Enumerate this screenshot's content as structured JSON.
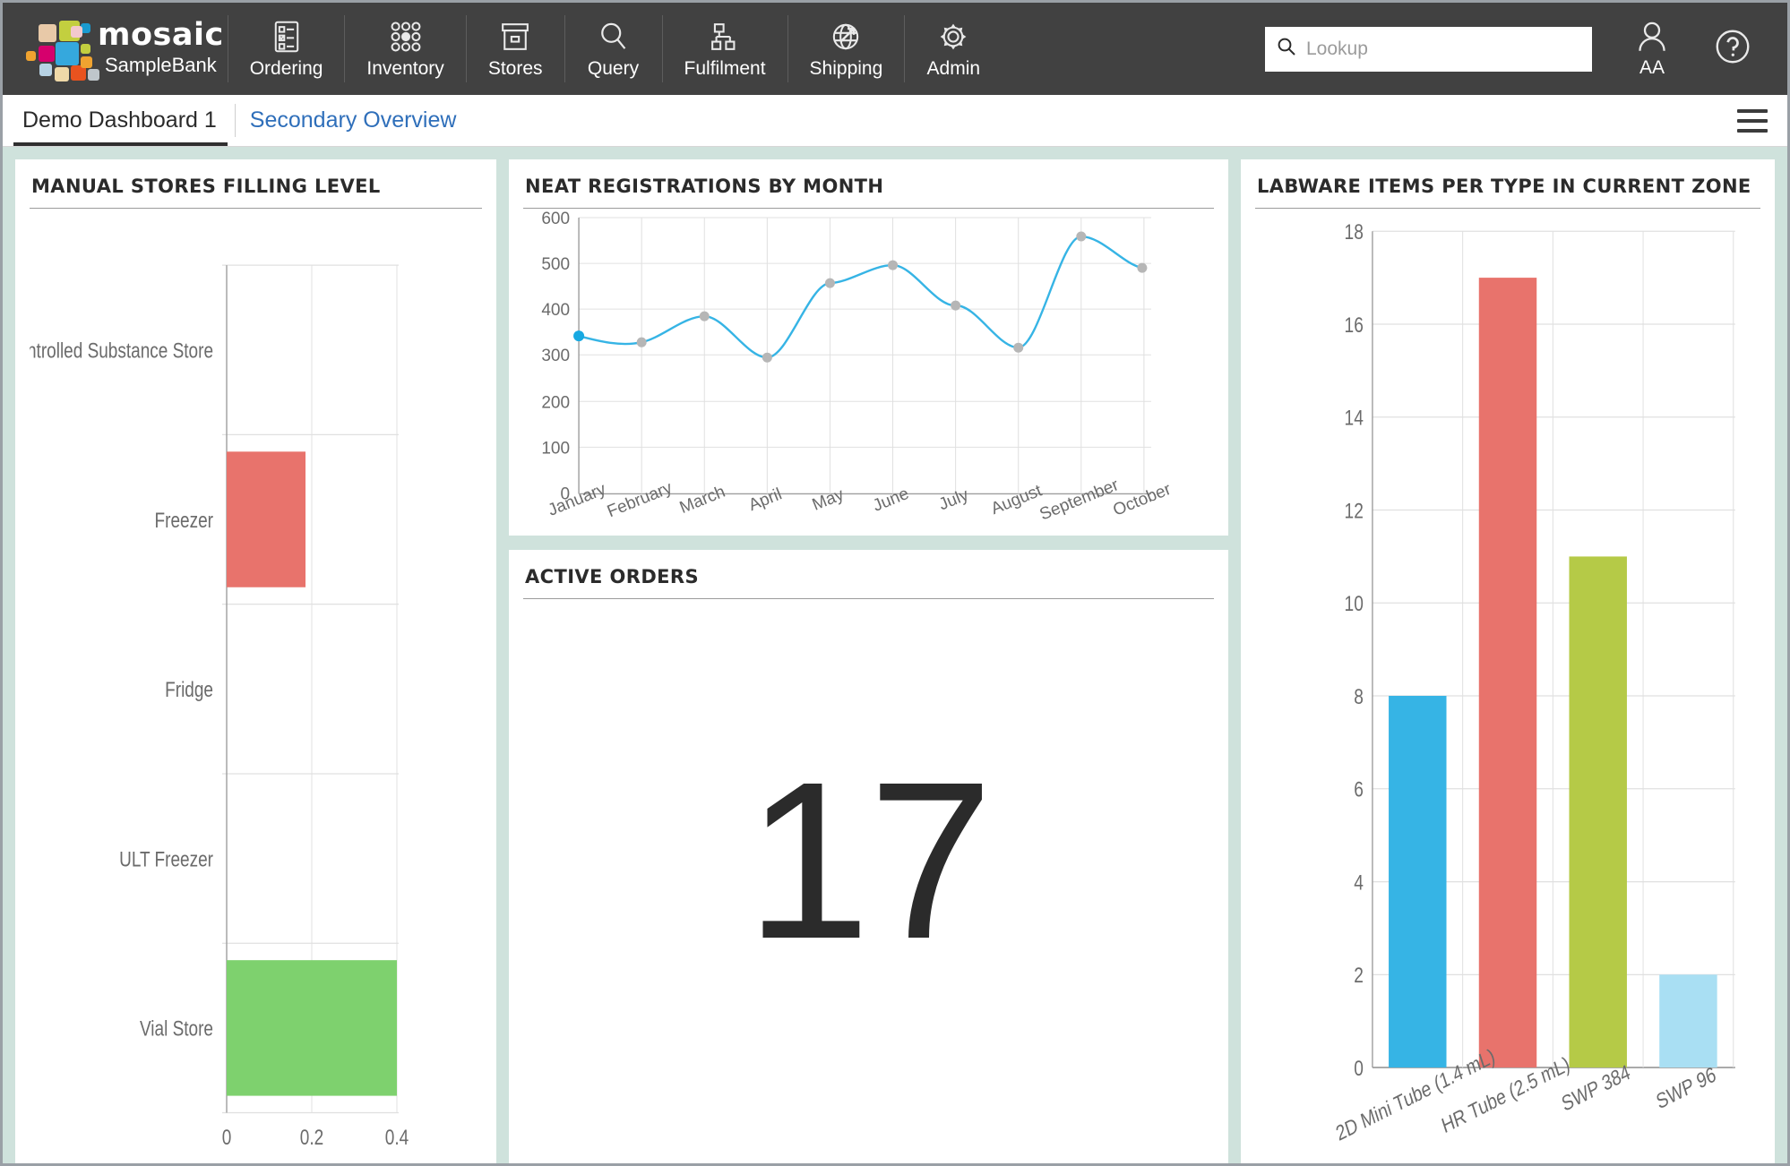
{
  "app": {
    "brand_name": "mosaic",
    "brand_sub": "SampleBank"
  },
  "topnav": {
    "items": [
      {
        "label": "Ordering",
        "icon": "clipboard-check-icon"
      },
      {
        "label": "Inventory",
        "icon": "dot-grid-icon"
      },
      {
        "label": "Stores",
        "icon": "archive-box-icon"
      },
      {
        "label": "Query",
        "icon": "magnifier-icon"
      },
      {
        "label": "Fulfilment",
        "icon": "hierarchy-icon"
      },
      {
        "label": "Shipping",
        "icon": "globe-arrow-icon"
      },
      {
        "label": "Admin",
        "icon": "gear-icon"
      }
    ],
    "search": {
      "placeholder": "Lookup",
      "value": "",
      "icon": "search-icon"
    },
    "user": {
      "initials": "AA",
      "icon": "user-icon"
    },
    "help": {
      "icon": "help-circle-icon"
    }
  },
  "tabs": [
    {
      "label": "Demo Dashboard 1",
      "active": true
    },
    {
      "label": "Secondary Overview",
      "active": false
    }
  ],
  "menu": {
    "icon": "hamburger-icon"
  },
  "cards": {
    "manual_stores": {
      "title": "MANUAL STORES FILLING LEVEL"
    },
    "neat_registrations": {
      "title": "NEAT REGISTRATIONS BY MONTH"
    },
    "active_orders": {
      "title": "ACTIVE ORDERS",
      "value": "17"
    },
    "labware_items": {
      "title": "LABWARE ITEMS PER TYPE IN CURRENT ZONE"
    }
  },
  "colors": {
    "accent_blue": "#36b4e5",
    "red": "#e8736c",
    "green": "#7ed16e",
    "olive": "#b5ca47",
    "light_blue": "#a9dff3",
    "board_bg": "#cfe2dc",
    "topnav_bg": "#414141",
    "tab_link": "#2f6fba"
  },
  "chart_data": [
    {
      "id": "manual_stores_filling_level",
      "type": "bar",
      "orientation": "horizontal",
      "title": "MANUAL STORES FILLING LEVEL",
      "xlabel": "",
      "ylabel": "",
      "categories": [
        "Controlled Substance Store",
        "Freezer",
        "Fridge",
        "ULT Freezer",
        "Vial Store"
      ],
      "values": [
        0,
        0.186,
        0,
        0,
        0.4
      ],
      "bar_colors": [
        "#e8736c",
        "#e8736c",
        "#7ed16e",
        "#7ed16e",
        "#7ed16e"
      ],
      "xlim": [
        0,
        0.4
      ],
      "xticks": [
        0,
        0.2,
        0.4
      ],
      "xticklabels": [
        "0",
        "0.2",
        "0.4"
      ],
      "grid": true,
      "legend": "none"
    },
    {
      "id": "neat_registrations_by_month",
      "type": "line",
      "title": "NEAT REGISTRATIONS BY MONTH",
      "xlabel": "",
      "ylabel": "",
      "categories": [
        "January",
        "February",
        "March",
        "April",
        "May",
        "June",
        "July",
        "August",
        "September",
        "October"
      ],
      "values": [
        343,
        330,
        387,
        297,
        458,
        497,
        408,
        318,
        560,
        490
      ],
      "ylim": [
        0,
        600
      ],
      "yticks": [
        0,
        100,
        200,
        300,
        400,
        500,
        600
      ],
      "yticklabels": [
        "0",
        "100",
        "200",
        "300",
        "400",
        "500",
        "600"
      ],
      "line_color": "#36b4e5",
      "marker": "circle",
      "smooth": true,
      "grid": true,
      "legend": "none"
    },
    {
      "id": "active_orders",
      "type": "table",
      "title": "ACTIVE ORDERS",
      "value": 17
    },
    {
      "id": "labware_items_per_type_in_current_zone",
      "type": "bar",
      "orientation": "vertical",
      "title": "LABWARE ITEMS PER TYPE IN CURRENT ZONE",
      "xlabel": "",
      "ylabel": "",
      "categories": [
        "2D Mini Tube (1.4 mL)",
        "HR Tube (2.5 mL)",
        "SWP 384",
        "SWP 96"
      ],
      "values": [
        8,
        17,
        11,
        2
      ],
      "bar_colors": [
        "#36b4e5",
        "#e8736c",
        "#b5ca47",
        "#a9dff3"
      ],
      "ylim": [
        0,
        18
      ],
      "yticks": [
        0,
        2,
        4,
        6,
        8,
        10,
        12,
        14,
        16,
        18
      ],
      "yticklabels": [
        "0",
        "2",
        "4",
        "6",
        "8",
        "10",
        "12",
        "14",
        "16",
        "18"
      ],
      "grid": true,
      "legend": "none"
    }
  ]
}
